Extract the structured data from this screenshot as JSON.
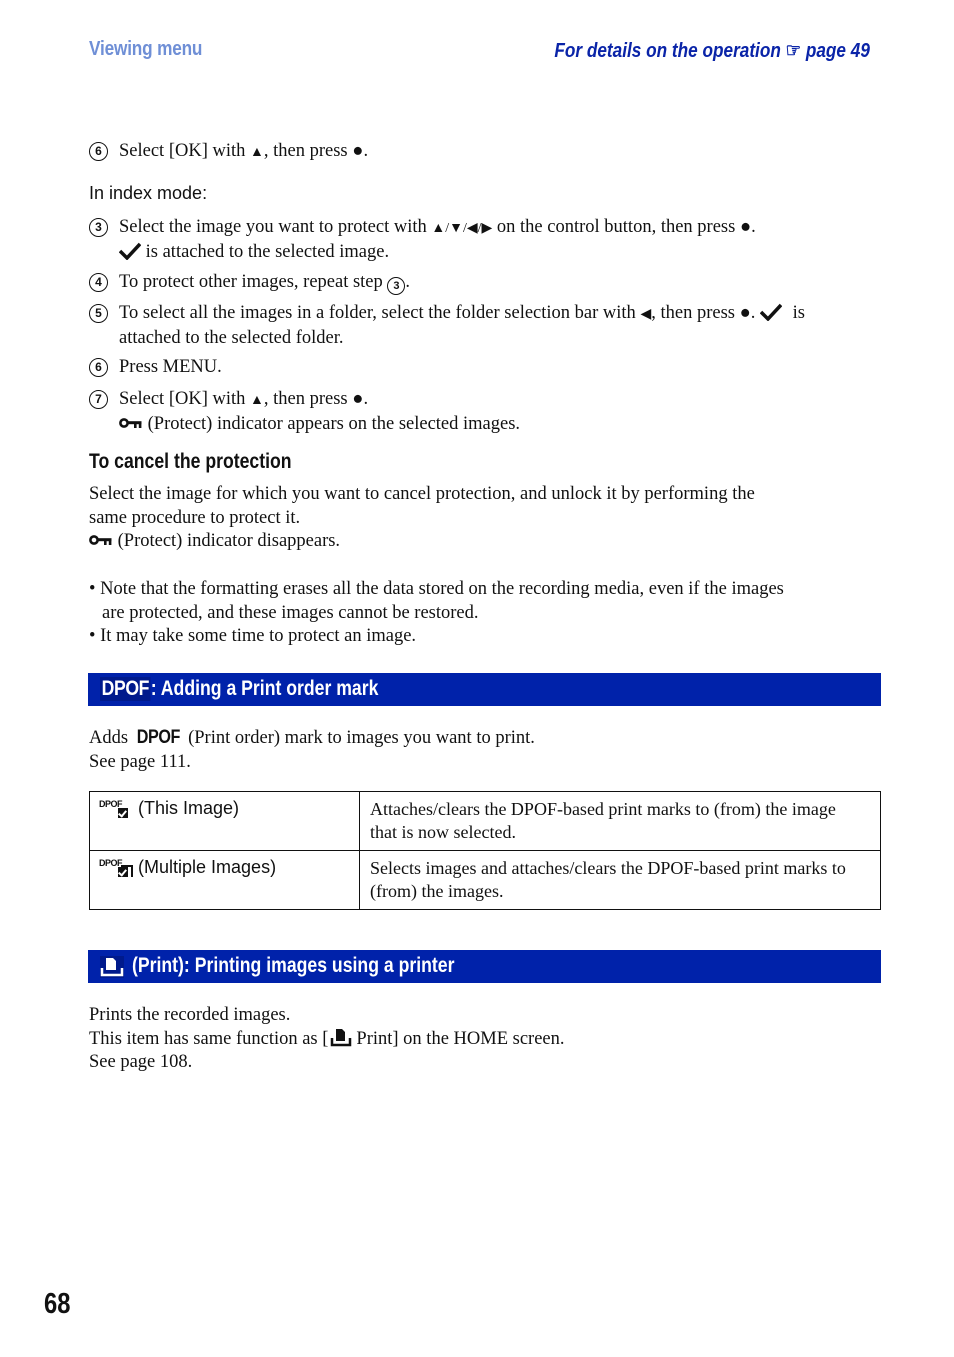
{
  "header": {
    "section": "Viewing menu",
    "reference_prefix": "For details on the operation",
    "reference_icon": "pointing-hand-icon",
    "reference_page": "page 49"
  },
  "top_step": {
    "num": "6",
    "text_before": "Select [OK] with",
    "symbol1": "▲",
    "text_mid": ", then press",
    "symbol2": "●",
    "text_after": "."
  },
  "index_mode_label": "In index mode:",
  "index_steps": [
    {
      "num": "3",
      "line1_before": "Select the image you want to protect with",
      "arrows": "▲/▼/◀/▶",
      "line1_mid": "on the control button, then press",
      "center": "●",
      "line1_after": ".",
      "line2": "is attached to the selected image."
    },
    {
      "num": "4",
      "text": "To protect other images, repeat step",
      "ref_num": "3",
      "after": "."
    },
    {
      "num": "5",
      "text_before": "To select all the images in a folder, select the folder selection bar with",
      "arrow": "◀",
      "text_mid": ", then press",
      "center": "●",
      "text_after": ".",
      "tail": "is",
      "line2": "attached to the selected folder."
    },
    {
      "num": "6",
      "text": "Press MENU."
    },
    {
      "num": "7",
      "text_before": "Select [OK] with",
      "symbol1": "▲",
      "text_mid": ", then press",
      "symbol2": "●",
      "text_after": ".",
      "line2": "(Protect) indicator appears on the selected images."
    }
  ],
  "cancel": {
    "heading": "To cancel the protection",
    "para1": "Select the image for which you want to cancel protection, and unlock it by performing the",
    "para2": "same procedure to protect it.",
    "para3": "(Protect) indicator disappears."
  },
  "notes": [
    {
      "line1": "Note that the formatting erases all the data stored on the recording media, even if the images",
      "line2": "are protected, and these images cannot be restored."
    },
    {
      "line1": "It may take some time to protect an image."
    }
  ],
  "dpof_section": {
    "badge": "DPOF",
    "title": ": Adding a Print order mark",
    "desc_before": "Adds",
    "desc_badge": "DPOF",
    "desc_after": "(Print order) mark to images you want to print.",
    "see_page": "See page 111.",
    "options": [
      {
        "icon": "dpof-this-image-icon",
        "icon_text": "DPOF",
        "label": "(This Image)",
        "desc1": "Attaches/clears the DPOF-based print marks to (from) the image",
        "desc2": "that is now selected."
      },
      {
        "icon": "dpof-multiple-images-icon",
        "icon_text": "DPOF",
        "label": "(Multiple Images)",
        "desc1": "Selects images and attaches/clears the DPOF-based print marks to",
        "desc2": "(from) the images."
      }
    ]
  },
  "print_section": {
    "title": "(Print): Printing images using a printer",
    "line1": "Prints the recorded images.",
    "line2_before": "This item has same function as [",
    "line2_after": "Print] on the HOME screen.",
    "line3": "See page 108."
  },
  "page_number": "68",
  "colors": {
    "header_light": "#6f8fd6",
    "header_dark": "#0a24a8",
    "section_bar": "#0022aa"
  }
}
